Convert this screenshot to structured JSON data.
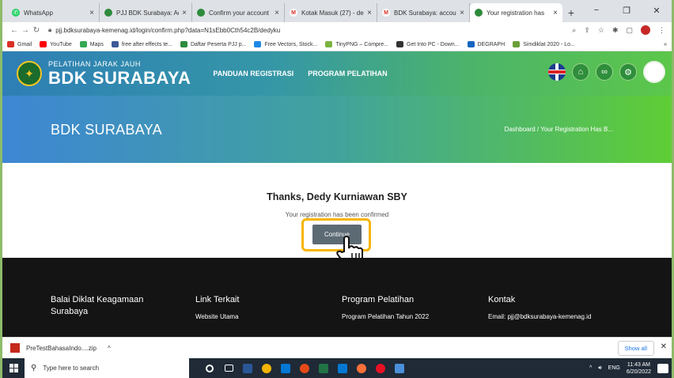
{
  "browser": {
    "tabs": [
      {
        "title": "WhatsApp",
        "color": "#25d366"
      },
      {
        "title": "PJJ BDK Surabaya: Adi",
        "color": "#2e8b3c"
      },
      {
        "title": "Confirm your account",
        "color": "#2e8b3c"
      },
      {
        "title": "Kotak Masuk (27) - de",
        "color": "#d93025"
      },
      {
        "title": "BDK Surabaya: accou",
        "color": "#d93025"
      },
      {
        "title": "Your registration has",
        "color": "#2e8b3c",
        "active": true
      }
    ],
    "new_tab": "+",
    "window_controls": [
      "−",
      "❐",
      "✕"
    ],
    "url": "pjj.bdksurabaya-kemenag.id/login/confirm.php?data=N1sEbb0Cth54c2B/dedyku",
    "bookmarks": [
      {
        "label": "Gmail",
        "color": "#d93025"
      },
      {
        "label": "YouTube",
        "color": "#ff0000"
      },
      {
        "label": "Maps",
        "color": "#34a853"
      },
      {
        "label": "free after effects te...",
        "color": "#3c5a99"
      },
      {
        "label": "Daftar Peserta PJJ p...",
        "color": "#2e8b3c"
      },
      {
        "label": "Free Vectors, Stock...",
        "color": "#1e88e5"
      },
      {
        "label": "TinyPNG – Compre...",
        "color": "#7cb342"
      },
      {
        "label": "Get Into PC - Down...",
        "color": "#333333"
      },
      {
        "label": "DEGRAPH",
        "color": "#1565c0"
      },
      {
        "label": "Simdiklat 2020 - Lo...",
        "color": "#689f38"
      }
    ],
    "bookmarks_more": "»"
  },
  "site": {
    "brand_small": "PELATIHAN JARAK JAUH",
    "brand_big": "BDK SURABAYA",
    "menu": [
      "PANDUAN REGISTRASI",
      "PROGRAM PELATIHAN"
    ],
    "hero_title": "BDK SURABAYA",
    "breadcrumb": "Dashboard / Your Registration Has B...",
    "message_title": "Thanks, Dedy Kurniawan SBY",
    "message_sub": "Your registration has been confirmed",
    "continue_label": "Continue",
    "footer": [
      {
        "head": "Balai Diklat Keagamaan Surabaya",
        "link": ""
      },
      {
        "head": "Link Terkait",
        "link": "Website Utama"
      },
      {
        "head": "Program Pelatihan",
        "link": "Program Pelatihan Tahun 2022"
      },
      {
        "head": "Kontak",
        "link": "Email: pjj@bdksurabaya-kemenag.id"
      }
    ]
  },
  "download": {
    "file": "PreTestBahasaIndo....zip",
    "show_all": "Show all"
  },
  "taskbar": {
    "search_placeholder": "Type here to search",
    "lang": "ENG",
    "time": "11:43 AM",
    "date": "6/20/2022",
    "apps": [
      "#ffffff",
      "#ffffff",
      "#2b5797",
      "#f4b400",
      "#0078d4",
      "#e64a19",
      "#217346",
      "#0078d4",
      "#ff7139",
      "#e81123",
      "#4a90d9"
    ]
  }
}
